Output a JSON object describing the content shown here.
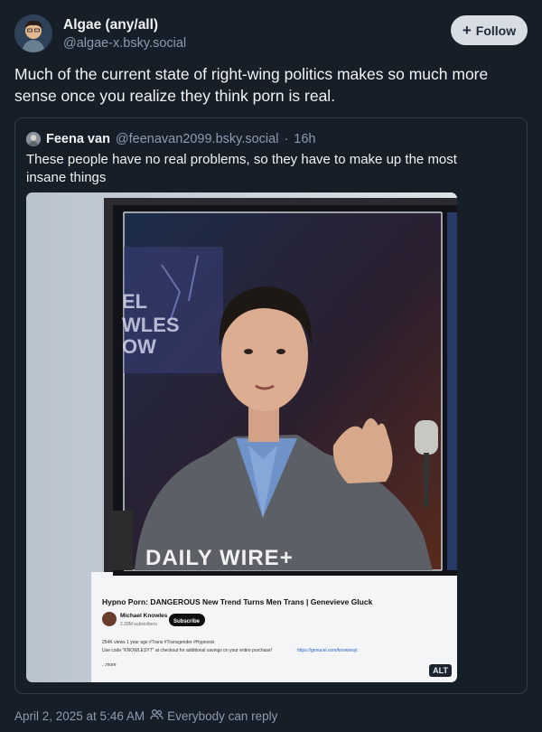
{
  "post": {
    "author_name": "Algae (any/all)",
    "author_handle": "@algae-x.bsky.social",
    "follow_label": "Follow",
    "text": "Much of the current state of right-wing politics makes so much more sense once you realize they think porn is real.",
    "timestamp": "April 2, 2025 at 5:46 AM",
    "reply_setting": "Everybody can reply"
  },
  "quote": {
    "author_name": "Feena van",
    "author_handle": "@feenavan2099.bsky.social",
    "separator": "·",
    "age": "16h",
    "text": "These people have no real problems, so they have to make up the most insane things",
    "image": {
      "alt_label": "ALT",
      "screen_logo": "DAILY WIRE+",
      "backdrop_text": [
        "EL",
        "WLES",
        "OW"
      ],
      "video_title": "Hypno Porn: DANGEROUS New Trend Turns Men Trans | Genevieve Gluck",
      "channel_name": "Michael Knowles",
      "subscribers": "2.28M subscribers",
      "subscribe_label": "Subscribe",
      "stats": "254K views  1 year ago  #Trans #Transgender #Hypnosis",
      "promo": "Use code \"KNOWLESYT\" at checkout for additional savings on your entire purchase!",
      "promo_link": "https://genucel.com/knowlesyt",
      "more_label": "...more"
    }
  },
  "colors": {
    "background": "#161e27",
    "text": "#f1f3f5",
    "muted": "#8c9cb0",
    "border": "#2e3c4d",
    "follow_bg": "#d8dde3"
  }
}
